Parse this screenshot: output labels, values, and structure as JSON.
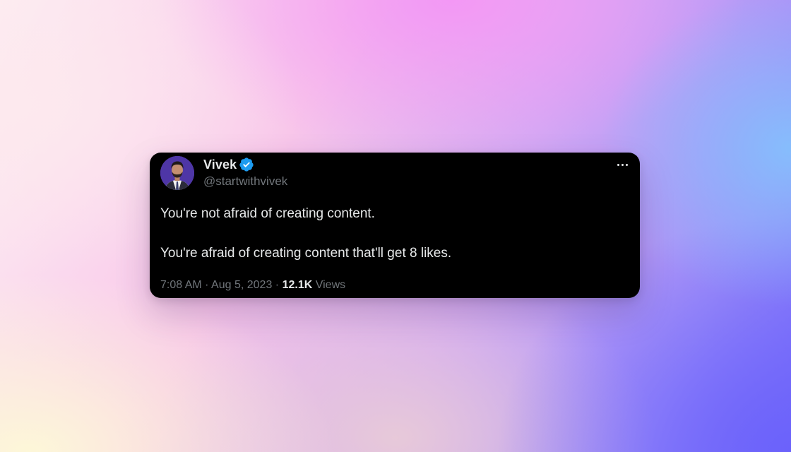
{
  "tweet": {
    "author": {
      "display_name": "Vivek",
      "handle": "@startwithvivek",
      "verified": true,
      "verified_badge_color": "#1d9bf0"
    },
    "text_lines": [
      "You're not afraid of creating content.",
      "You're afraid of creating content that'll get 8 likes."
    ],
    "time": "7:08 AM",
    "separator": "·",
    "date": "Aug 5, 2023",
    "views_count": "12.1K",
    "views_label": "Views"
  },
  "icons": {
    "avatar": "profile-photo",
    "verified": "verified-badge-icon",
    "more": "more-horizontal-icon"
  },
  "colors": {
    "card_background": "#000000",
    "primary_text": "#e7e9ea",
    "secondary_text": "#71767b",
    "avatar_background": "#5a3fb0"
  }
}
